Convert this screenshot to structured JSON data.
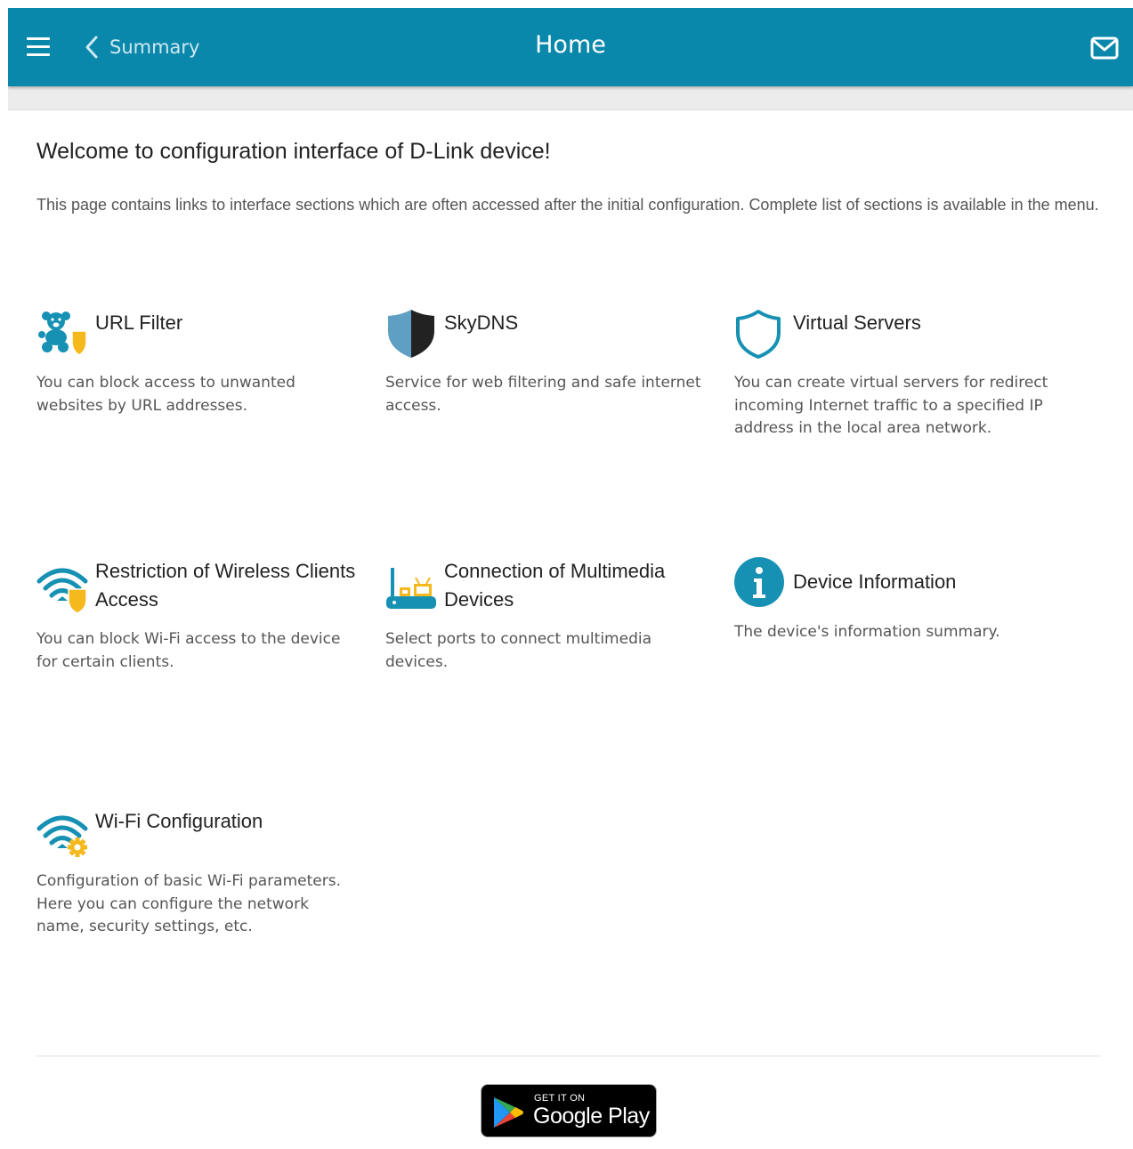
{
  "header": {
    "back_label": "Summary",
    "title": "Home",
    "color": "#0a88ab",
    "menu_icon": "hamburger-icon",
    "back_icon": "chevron-left-icon",
    "mail_icon": "mail-icon"
  },
  "main": {
    "heading": "Welcome to configuration interface of D-Link device!",
    "intro": "This page contains links to interface sections which are often accessed after the initial configuration. Complete list of sections is available in the menu.",
    "tiles": [
      {
        "title": "URL Filter",
        "description": "You can block access to unwanted websites by URL addresses.",
        "icon": "teddy-bear-shield-icon"
      },
      {
        "title": "SkyDNS",
        "description": "Service for web filtering and safe internet access.",
        "icon": "skydns-shield-icon"
      },
      {
        "title": "Virtual Servers",
        "description": "You can create virtual servers for redirect incoming Internet traffic to a specified IP address in the local area network.",
        "icon": "shield-outline-icon"
      },
      {
        "title": "Restriction of Wireless Clients Access",
        "description": "You can block Wi-Fi access to the device for certain clients.",
        "icon": "wifi-shield-icon"
      },
      {
        "title": "Connection of Multimedia Devices",
        "description": "Select ports to connect multimedia devices.",
        "icon": "router-tv-icon"
      },
      {
        "title": "Device Information",
        "description": "The device's information summary.",
        "icon": "info-icon"
      },
      {
        "title": "Wi-Fi Configuration",
        "description": "Configuration of basic Wi-Fi parameters. Here you can configure the network name, security settings, etc.",
        "icon": "wifi-gear-icon"
      }
    ]
  },
  "footer": {
    "badge_small": "GET IT ON",
    "badge_big": "Google Play",
    "badge_icon": "google-play-icon"
  },
  "colors": {
    "accent": "#0a88ab",
    "icon_teal": "#1791b3",
    "icon_yellow": "#f5b91d"
  }
}
